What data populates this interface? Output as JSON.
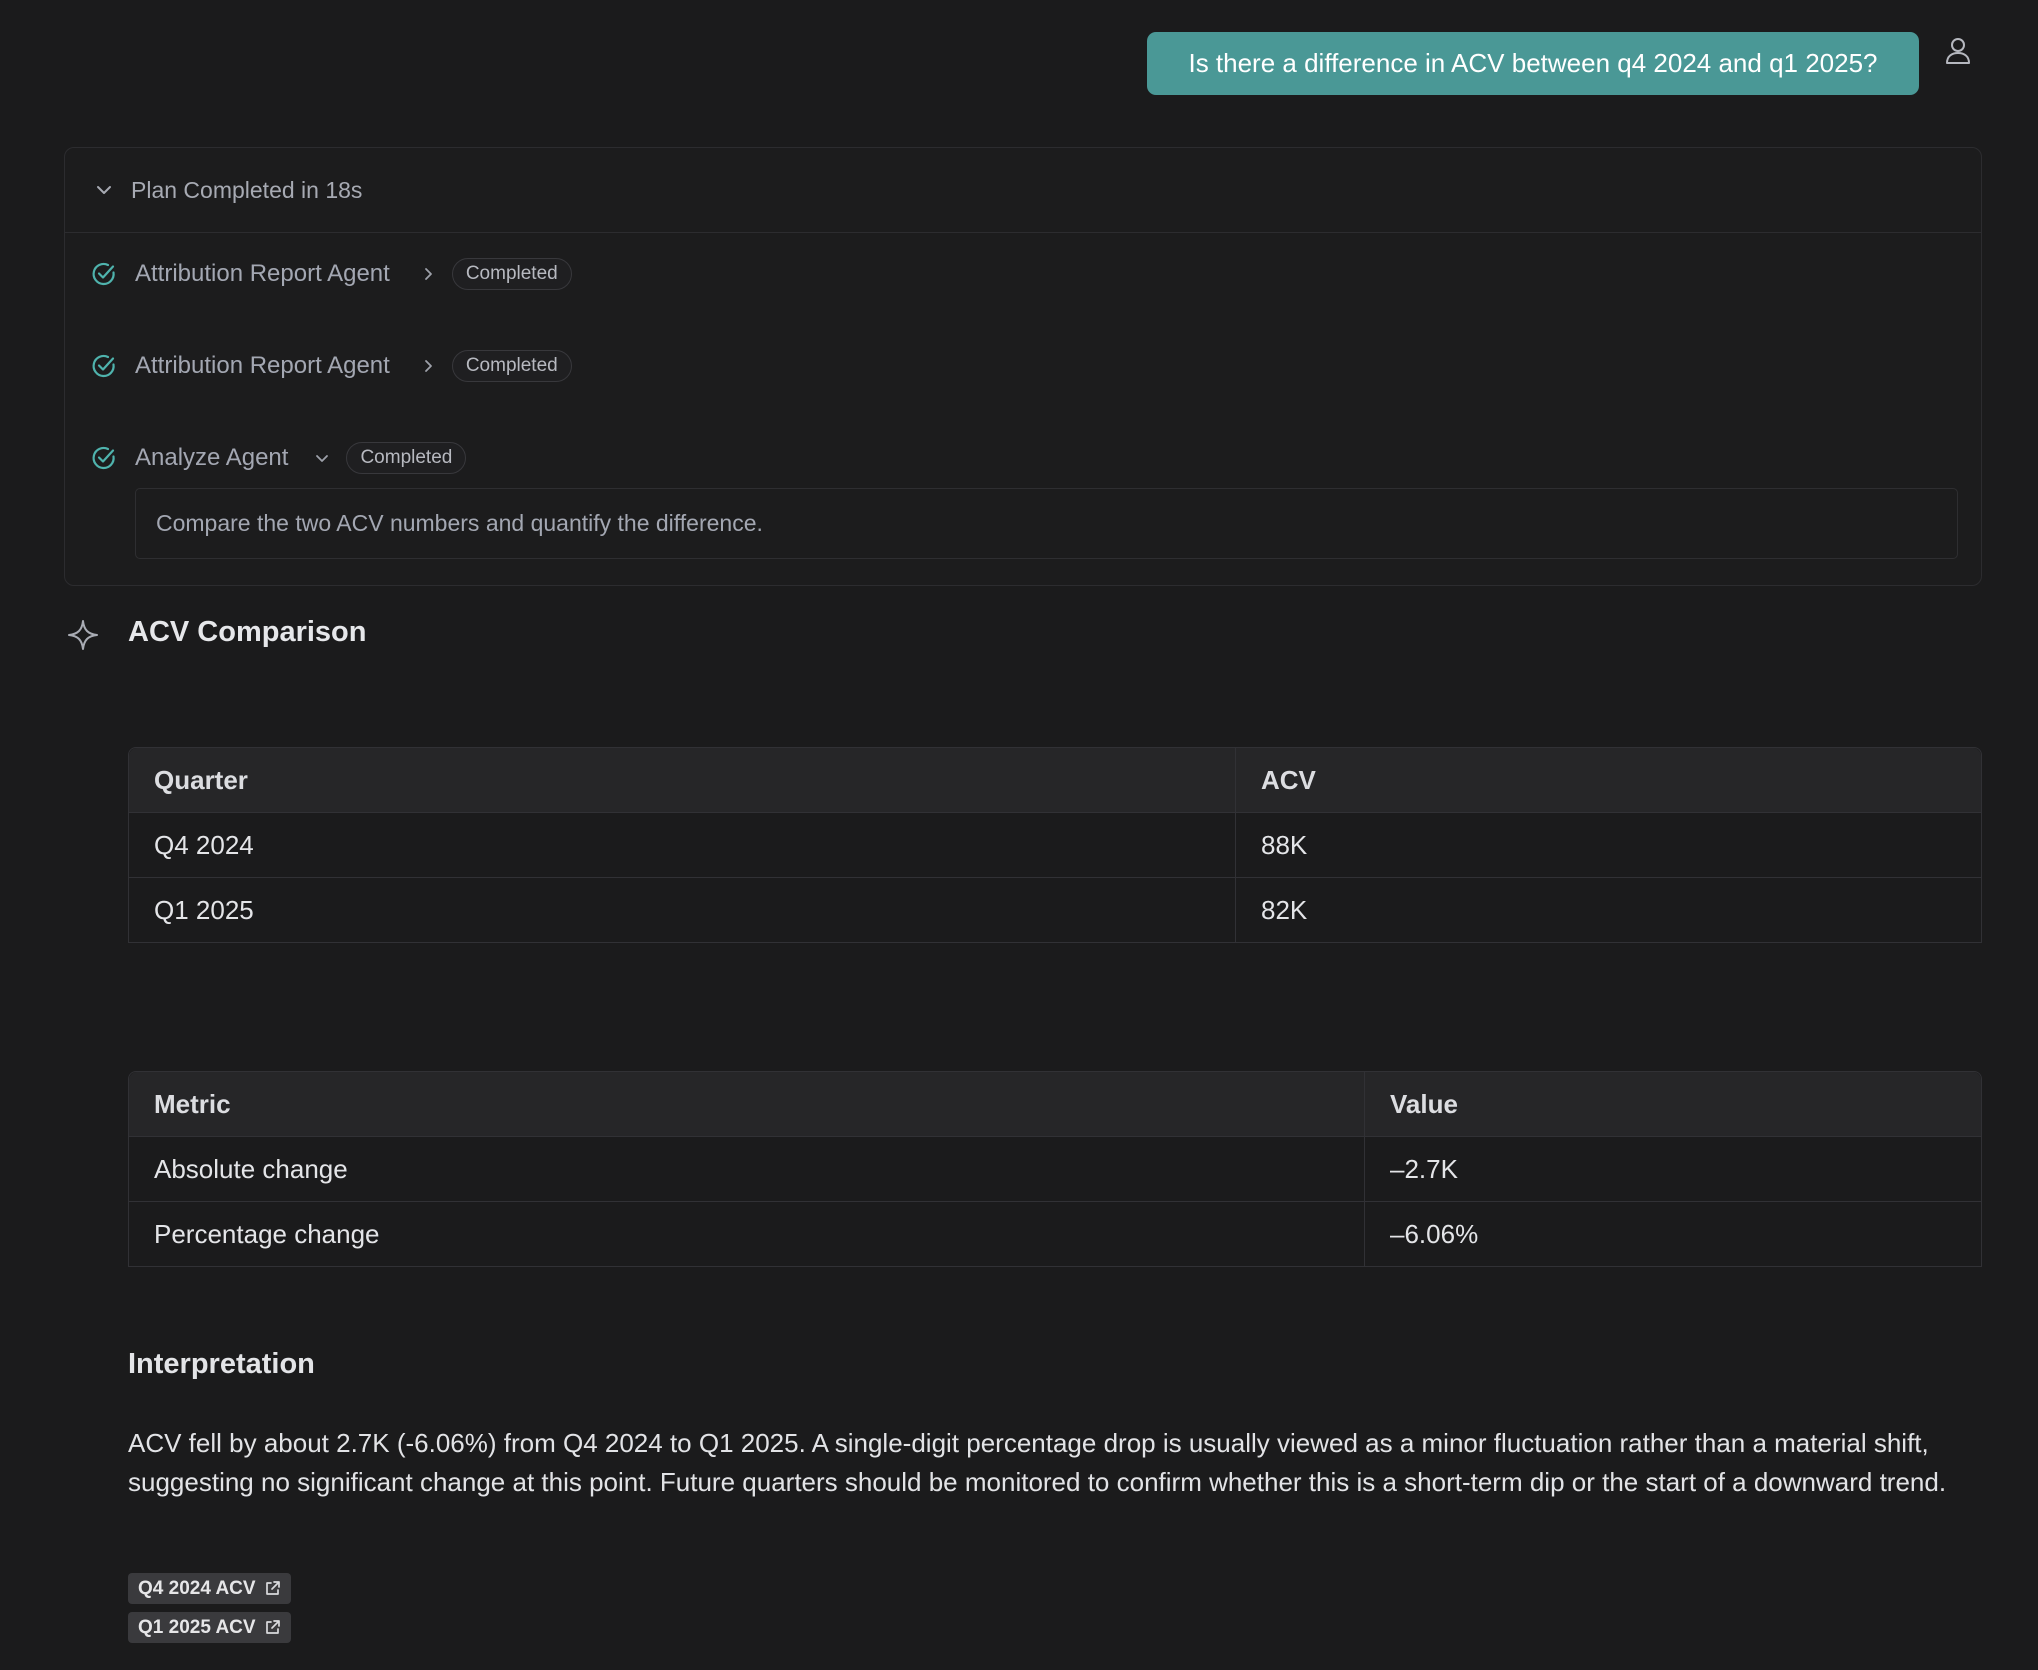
{
  "user_message": "Is there a difference in ACV between q4 2024 and q1 2025?",
  "plan": {
    "title": "Plan Completed in 18s",
    "steps": [
      {
        "name": "Attribution Report Agent",
        "status": "Completed"
      },
      {
        "name": "Attribution Report Agent",
        "status": "Completed"
      },
      {
        "name": "Analyze Agent",
        "status": "Completed",
        "description": "Compare the two ACV numbers and quantify the difference."
      }
    ]
  },
  "answer": {
    "title": "ACV Comparison",
    "table1": {
      "headers": [
        "Quarter",
        "ACV"
      ],
      "rows": [
        [
          "Q4 2024",
          "88K"
        ],
        [
          "Q1 2025",
          "82K"
        ]
      ]
    },
    "table2": {
      "headers": [
        "Metric",
        "Value"
      ],
      "rows": [
        [
          "Absolute change",
          "–2.7K"
        ],
        [
          "Percentage change",
          "–6.06%"
        ]
      ]
    },
    "interpretation_title": "Interpretation",
    "interpretation_text": "ACV fell by about 2.7K (-6.06%) from Q4 2024 to Q1 2025. A single-digit percentage drop is usually viewed as a minor fluctuation rather than a material shift, suggesting no significant change at this point. Future quarters should be monitored to confirm whether this is a short-term dip or the start of a downward trend.",
    "sources": [
      "Q4 2024 ACV",
      "Q1 2025 ACV"
    ]
  },
  "colors": {
    "background": "#1b1b1c",
    "user_bubble": "#4a9896",
    "check_icon": "#4fb3ad"
  }
}
